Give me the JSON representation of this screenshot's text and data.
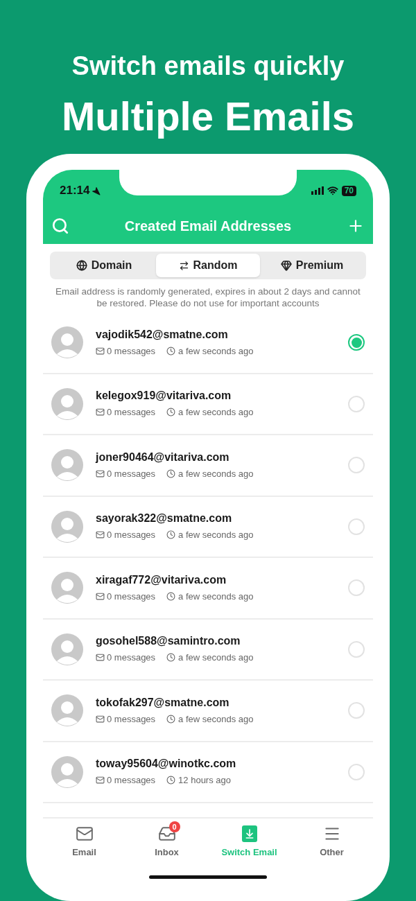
{
  "headline": {
    "subtitle": "Switch emails quickly",
    "title": "Multiple Emails"
  },
  "status_bar": {
    "time": "21:14",
    "battery": "70"
  },
  "header": {
    "title": "Created Email Addresses"
  },
  "tabs": [
    {
      "label": "Domain",
      "kind": "globe",
      "selected": false
    },
    {
      "label": "Random",
      "kind": "shuffle",
      "selected": true
    },
    {
      "label": "Premium",
      "kind": "gem",
      "selected": false
    }
  ],
  "notice": "Email address is randomly generated, expires in about 2 days and cannot be restored. Please do not use for important accounts",
  "accounts": [
    {
      "email": "vajodik542@smatne.com",
      "messages": "0 messages",
      "time": "a few seconds ago",
      "selected": true
    },
    {
      "email": "kelegox919@vitariva.com",
      "messages": "0 messages",
      "time": "a few seconds ago",
      "selected": false
    },
    {
      "email": "joner90464@vitariva.com",
      "messages": "0 messages",
      "time": "a few seconds ago",
      "selected": false
    },
    {
      "email": "sayorak322@smatne.com",
      "messages": "0 messages",
      "time": "a few seconds ago",
      "selected": false
    },
    {
      "email": "xiragaf772@vitariva.com",
      "messages": "0 messages",
      "time": "a few seconds ago",
      "selected": false
    },
    {
      "email": "gosohel588@samintro.com",
      "messages": "0 messages",
      "time": "a few seconds ago",
      "selected": false
    },
    {
      "email": "tokofak297@smatne.com",
      "messages": "0 messages",
      "time": "a few seconds ago",
      "selected": false
    },
    {
      "email": "toway95604@winotkc.com",
      "messages": "0 messages",
      "time": "12 hours ago",
      "selected": false
    }
  ],
  "bottom_nav": [
    {
      "label": "Email",
      "kind": "email",
      "selected": false
    },
    {
      "label": "Inbox",
      "kind": "inbox",
      "badge": "0",
      "selected": false
    },
    {
      "label": "Switch Email",
      "kind": "switch",
      "selected": true
    },
    {
      "label": "Other",
      "kind": "other",
      "selected": false
    }
  ]
}
